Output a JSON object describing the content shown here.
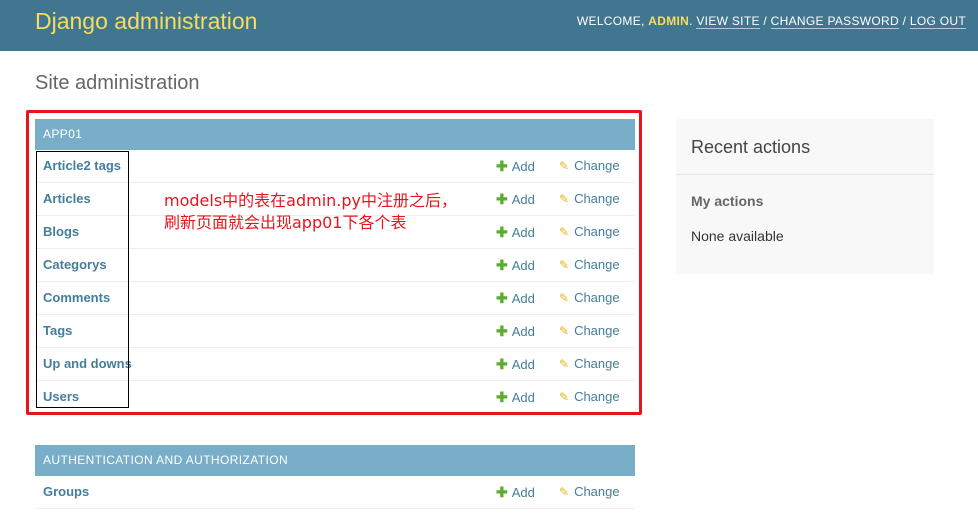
{
  "header": {
    "brand": "Django administration",
    "welcome": "WELCOME, ",
    "username": "ADMIN",
    "dot": ".",
    "view_site": "VIEW SITE",
    "change_password": "CHANGE PASSWORD",
    "log_out": "LOG OUT",
    "sep": "/"
  },
  "page_title": "Site administration",
  "modules": [
    {
      "caption": "APP01",
      "rows": [
        {
          "model": "Article2 tags",
          "add": "Add",
          "change": "Change"
        },
        {
          "model": "Articles",
          "add": "Add",
          "change": "Change"
        },
        {
          "model": "Blogs",
          "add": "Add",
          "change": "Change"
        },
        {
          "model": "Categorys",
          "add": "Add",
          "change": "Change"
        },
        {
          "model": "Comments",
          "add": "Add",
          "change": "Change"
        },
        {
          "model": "Tags",
          "add": "Add",
          "change": "Change"
        },
        {
          "model": "Up and downs",
          "add": "Add",
          "change": "Change"
        },
        {
          "model": "Users",
          "add": "Add",
          "change": "Change"
        }
      ]
    },
    {
      "caption": "AUTHENTICATION AND AUTHORIZATION",
      "rows": [
        {
          "model": "Groups",
          "add": "Add",
          "change": "Change"
        }
      ]
    }
  ],
  "annotation": {
    "line1": "models中的表在admin.py中注册之后，",
    "line2": "刷新页面就会出现app01下各个表"
  },
  "recent_actions": {
    "title": "Recent actions",
    "subtitle": "My actions",
    "empty_text": "None available"
  },
  "colors": {
    "header_bg": "#417690",
    "brand": "#f5dd5d",
    "caption_bg": "#79aec8",
    "link": "#447e9b",
    "add_icon": "#5aad2c",
    "change_icon": "#e8b318",
    "annotation": "#e8141d"
  },
  "icons": {
    "add": "plus-icon",
    "change": "pencil-icon"
  }
}
